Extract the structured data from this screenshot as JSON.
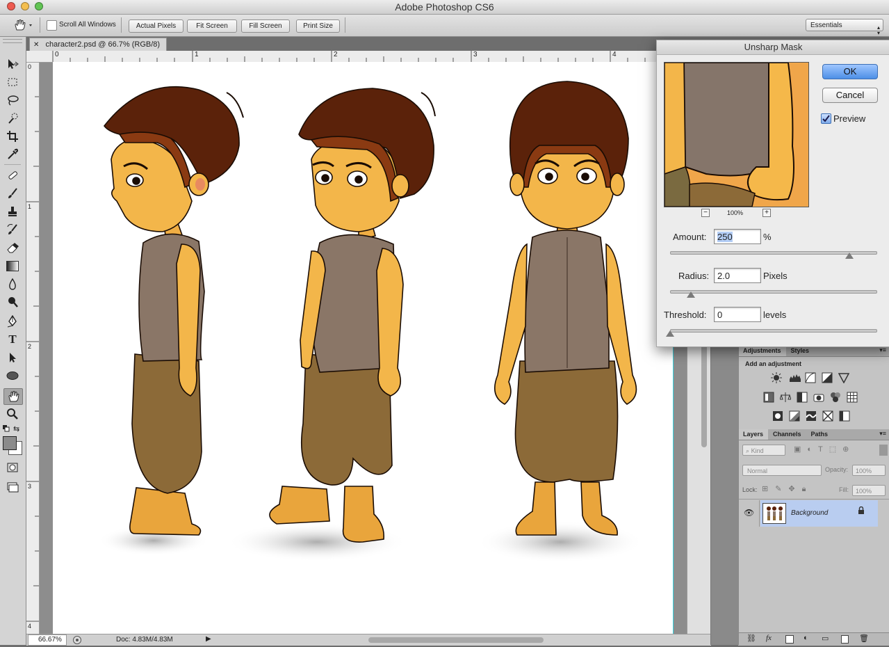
{
  "window": {
    "title": "Adobe Photoshop CS6"
  },
  "options_bar": {
    "scroll_all_windows": "Scroll All Windows",
    "buttons": [
      "Actual Pixels",
      "Fit Screen",
      "Fill Screen",
      "Print Size"
    ],
    "workspace": "Essentials"
  },
  "document": {
    "tab_title": "character2.psd @ 66.7% (RGB/8)",
    "ruler_top_labels": [
      "0",
      "1",
      "2",
      "3",
      "4"
    ],
    "ruler_left_labels": [
      "0",
      "1",
      "2",
      "3",
      "4"
    ]
  },
  "status_bar": {
    "zoom": "66.67%",
    "doc_size": "Doc: 4.83M/4.83M"
  },
  "dialog": {
    "title": "Unsharp Mask",
    "ok": "OK",
    "cancel": "Cancel",
    "preview_label": "Preview",
    "preview_checked": true,
    "preview_zoom": "100%",
    "amount_label": "Amount:",
    "amount_value": "250",
    "amount_unit": "%",
    "amount_slider_fraction": 0.87,
    "radius_label": "Radius:",
    "radius_value": "2.0",
    "radius_unit": "Pixels",
    "radius_slider_fraction": 0.1,
    "threshold_label": "Threshold:",
    "threshold_value": "0",
    "threshold_unit": "levels",
    "threshold_slider_fraction": 0.0
  },
  "adjustments_panel": {
    "tabs": [
      "Adjustments",
      "Styles"
    ],
    "subtitle": "Add an adjustment"
  },
  "layers_panel": {
    "tabs": [
      "Layers",
      "Channels",
      "Paths"
    ],
    "kind_filter": "Kind",
    "blend_mode": "Normal",
    "opacity_label": "Opacity:",
    "opacity_value": "100%",
    "lock_label": "Lock:",
    "fill_label": "Fill:",
    "fill_value": "100%",
    "layers": [
      {
        "name": "Background",
        "visible": true,
        "locked": true
      }
    ]
  },
  "colors": {
    "accent": "#2f6fd6",
    "layer_selected": "#b9cdf0",
    "skin": "#f3b64a",
    "hair": "#5b220a",
    "vest": "#8a7667",
    "pants": "#8c6a38"
  }
}
